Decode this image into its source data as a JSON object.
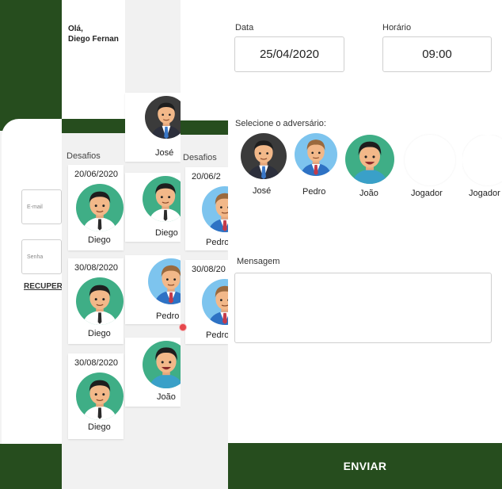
{
  "login": {
    "email_placeholder": "E-mail",
    "password_placeholder": "Senha",
    "recover_label": "RECUPER"
  },
  "home": {
    "greeting_line1": "Olá,",
    "greeting_line2": "Diego Fernan",
    "challenges_title": "Desafios",
    "top_opponent": "José",
    "challenges": [
      {
        "date": "20/06/2020",
        "player": "Diego",
        "opponent": "Diego"
      },
      {
        "date": "30/08/2020",
        "player": "Diego",
        "opponent": "Pedro"
      },
      {
        "date": "30/08/2020",
        "player": "Diego",
        "opponent": "João"
      }
    ]
  },
  "third": {
    "challenges_title": "Desafios",
    "cards": [
      {
        "date": "20/06/2",
        "name": "Pedro"
      },
      {
        "date": "30/08/20",
        "name": "Pedro"
      }
    ]
  },
  "form": {
    "date_label": "Data",
    "date_value": "25/04/2020",
    "time_label": "Horário",
    "time_value": "09:00",
    "opponent_prompt": "Selecione o adversário:",
    "opponents": [
      {
        "name": "José",
        "avatar": "jose-avatar"
      },
      {
        "name": "Pedro",
        "avatar": "pedro-avatar"
      },
      {
        "name": "João",
        "avatar": "joao-avatar"
      },
      {
        "name": "Jogador",
        "avatar": "empty-avatar"
      },
      {
        "name": "Jogador",
        "avatar": "empty-avatar"
      }
    ],
    "message_label": "Mensagem",
    "message_value": "",
    "send_label": "ENVIAR"
  },
  "colors": {
    "brand_green": "#264d1e",
    "avatar_teal": "#3fae86",
    "avatar_sky": "#7dc4ee",
    "record_dot": "#e6474c"
  }
}
